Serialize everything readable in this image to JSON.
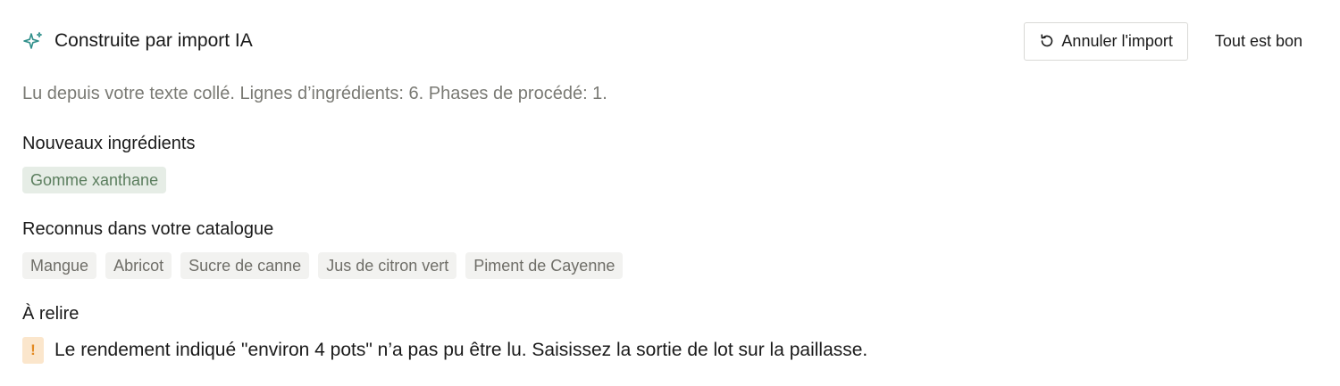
{
  "header": {
    "title": "Construite par import IA",
    "undo_label": "Annuler l'import",
    "confirm_label": "Tout est bon"
  },
  "summary": "Lu depuis votre texte collé. Lignes d’ingrédients: 6. Phases de procédé: 1.",
  "new_ingredients": {
    "label": "Nouveaux ingrédients",
    "items": [
      "Gomme xanthane"
    ]
  },
  "known_ingredients": {
    "label": "Reconnus dans votre catalogue",
    "items": [
      "Mangue",
      "Abricot",
      "Sucre de canne",
      "Jus de citron vert",
      "Piment de Cayenne"
    ]
  },
  "review": {
    "label": "À relire",
    "badge": "!",
    "message": "Le rendement indiqué \"environ 4 pots\" n’a pas pu être lu. Saisissez la sortie de lot sur la paillasse."
  },
  "colors": {
    "accent_teal": "#2f8f8a",
    "chip_new_bg": "#e6ede6",
    "chip_new_text": "#5b7e5e",
    "chip_known_bg": "#f2f2f0",
    "warning_bg": "#fbe6cc",
    "warning_text": "#e38a22"
  },
  "icons": {
    "title": "sparkle-icon",
    "undo": "undo-icon"
  }
}
